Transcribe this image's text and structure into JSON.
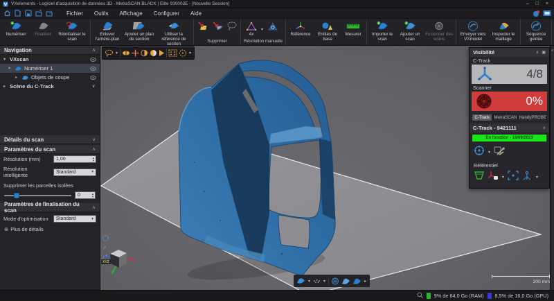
{
  "window": {
    "title": "VXelements - Logiciel d'acquisition de données 3D - MetraSCAN BLACK | Elite 930003E - [Nouvelle Session]",
    "minimize": "–",
    "maximize": "□",
    "close": "×"
  },
  "menu": {
    "items": [
      {
        "label": "Fichier"
      },
      {
        "label": "Outils"
      },
      {
        "label": "Affichage"
      },
      {
        "label": "Configurer"
      },
      {
        "label": "Aide"
      }
    ]
  },
  "toolbar": {
    "numeriser": "Numériser",
    "finaliser": "Finaliser",
    "reinitialiser": "Réinitialiser le scan",
    "enlever": "Enlever l'arrière-plan",
    "ajouter_plan": "Ajouter un plan de section",
    "utiliser_ref": "Utiliser la référence de section",
    "supprimer_group": "Supprimer",
    "resolution_group": "Résolution manuelle",
    "res_4x": "4x",
    "reference": "Référence",
    "entites": "Entités de base",
    "mesurer": "Mesurer",
    "importer": "Importer le scan",
    "ajouter_scan": "Ajouter un scan",
    "fusionner": "Fusionner des scans",
    "envoyer": "Envoyer vers VXmodel",
    "inspecter": "Inspecter le maillage",
    "sequence": "Séquence guidée"
  },
  "navigation": {
    "title": "Navigation",
    "vxscan": "VXscan",
    "numeriser1": "Numériser 1",
    "objets": "Objets de coupe",
    "scene": "Scène du C-Track"
  },
  "scan": {
    "details_header": "Détails du scan",
    "params_header": "Paramètres du scan",
    "resolution_label": "Résolution (mm)",
    "resolution_value": "1,00",
    "res_intel_label": "Résolution intelligente",
    "res_intel_value": "Standard",
    "parcelles_label": "Supprimer les parcelles isolées",
    "parcelles_value": "0",
    "finalisation_header": "Paramètres de finalisation du scan",
    "optimisation_label": "Mode d'optimisation",
    "optimisation_value": "Standard",
    "plus_details": "Plus de détails"
  },
  "visibility": {
    "title": "Visibilité",
    "ctrack_label": "C-Track",
    "ctrack_count": "4/8",
    "scanner_label": "Scanner",
    "scanner_percent": "0%",
    "tabs": [
      {
        "label": "C-Track"
      },
      {
        "label": "MetraSCAN"
      },
      {
        "label": "HandyPROBE"
      }
    ],
    "device_header": "C-Track - 9421111",
    "status_text": "En fonction - 18/09/2023",
    "referentiel_label": "Référentiel"
  },
  "viewport": {
    "scale_label": "200 mm",
    "axis_label": "XYZ"
  },
  "status_bar": {
    "ram": "9% de 64,0 Go (RAM)",
    "gpu": "8,5% de 16,0 Go (GPU)"
  },
  "colors": {
    "accent_blue": "#2f7fd0",
    "scanner_red": "#d23b3b",
    "status_green": "#1ae51a",
    "ram_green": "#27b727",
    "gpu_blue": "#3a3ad9",
    "model_blue": "#2e6da6"
  },
  "icons": {
    "chevron_up": "∧",
    "chevron_down": "∨",
    "expand_right": "▸",
    "expand_down": "▾",
    "dropdown": "▾",
    "plus_circle": "⊕",
    "float": "▣",
    "collapse_left": "«"
  }
}
